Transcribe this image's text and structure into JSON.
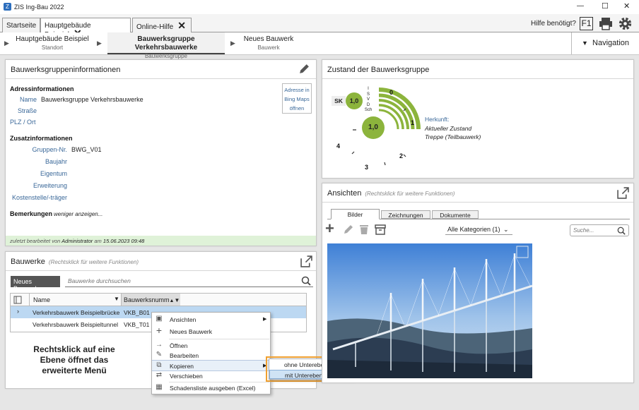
{
  "app": {
    "title": "ZIS Ing-Bau 2022"
  },
  "window": {
    "minimize": "—",
    "maximize": "☐",
    "close": "✕"
  },
  "tabs": [
    {
      "label": "Startseite"
    },
    {
      "label": "Hauptgebäude Beispiel"
    },
    {
      "label": "Online-Hilfe"
    }
  ],
  "help": {
    "label": "Hilfe benötigt?",
    "f1": "F1"
  },
  "breadcrumbs": [
    {
      "title": "Hauptgebäude Beispiel",
      "sub": "Standort"
    },
    {
      "title": "Bauwerksgruppe Verkehrsbauwerke",
      "sub": "Bauwerksgruppe"
    },
    {
      "title": "Neues Bauwerk",
      "sub": "Bauwerk"
    }
  ],
  "navigation": {
    "label": "Navigation"
  },
  "info": {
    "title": "Bauwerksgruppeninformationen",
    "address_header": "Adressinformationen",
    "name_label": "Name",
    "name_value": "Bauwerksgruppe Verkehrsbauwerke",
    "street_label": "Straße",
    "plz_label": "PLZ / Ort",
    "maps_line1": "Adresse in",
    "maps_line2": "Bing Maps",
    "maps_line3": "öffnen",
    "extra_header": "Zusatzinformationen",
    "group_nr_label": "Gruppen-Nr.",
    "group_nr_value": "BWG_V01",
    "year_label": "Baujahr",
    "owner_label": "Eigentum",
    "ext_label": "Erweiterung",
    "cost_label": "Kostenstelle/-träger",
    "remarks_label": "Bemerkungen",
    "remarks_toggle": "weniger anzeigen...",
    "footer_prefix": "zuletzt bearbeitet von",
    "footer_user": "Administrator",
    "footer_mid": "am",
    "footer_date": "15.06.2023 09:48"
  },
  "bauwerke": {
    "title": "Bauwerke",
    "hint": "(Rechtsklick für weitere Funktionen)",
    "new_button": "Neues Bauwerk",
    "search_placeholder": "Bauwerke durchsuchen",
    "col_name": "Name",
    "col_number": "Bauwerksnumm",
    "rows": [
      {
        "name": "Verkehrsbauwerk Beispielbrücke",
        "number": "VKB_B01"
      },
      {
        "name": "Verkehrsbauwerk Beispieltunnel",
        "number": "VKB_T01"
      }
    ],
    "annotation": [
      "Rechtsklick auf eine",
      "Ebene öffnet das",
      "erweiterte Menü"
    ]
  },
  "context_menu": {
    "items": [
      {
        "label": "Ansichten",
        "icon": "image-icon"
      },
      {
        "label": "Neues Bauwerk",
        "icon": "plus-icon"
      },
      {
        "label": "Öffnen",
        "icon": "arrow-right-icon"
      },
      {
        "label": "Bearbeiten",
        "icon": "pencil-icon"
      },
      {
        "label": "Kopieren",
        "icon": "copy-icon"
      },
      {
        "label": "Verschieben",
        "icon": "move-icon"
      },
      {
        "label": "Schadensliste ausgeben (Excel)",
        "icon": "table-icon"
      }
    ],
    "submenu": [
      {
        "label": "ohne Unterebenen"
      },
      {
        "label": "mit Unterebenen"
      }
    ]
  },
  "zustand": {
    "title": "Zustand der Bauwerksgruppe",
    "sk_label": "SK",
    "sk_value": "1,0",
    "center_value": "1,0",
    "scale": [
      "0",
      "1",
      "2",
      "3",
      "4"
    ],
    "axis": [
      "I",
      "S",
      "V",
      "D",
      "Sch"
    ],
    "origin_label": "Herkunft:",
    "origin_line1": "Aktueller Zustand",
    "origin_line2": "Treppe (Teilbauwerk)"
  },
  "ansichten": {
    "title": "Ansichten",
    "hint": "(Rechtsklick für weitere Funktionen)",
    "tabs": [
      {
        "label": "Bilder"
      },
      {
        "label": "Zeichnungen"
      },
      {
        "label": "Dokumente"
      }
    ],
    "category": "Alle Kategorien (1)",
    "search_placeholder": "Suche..."
  },
  "colors": {
    "accent": "#8cb43c",
    "orange": "#f0a030",
    "link": "#3a6899",
    "footer_bg": "#dff2d8"
  }
}
